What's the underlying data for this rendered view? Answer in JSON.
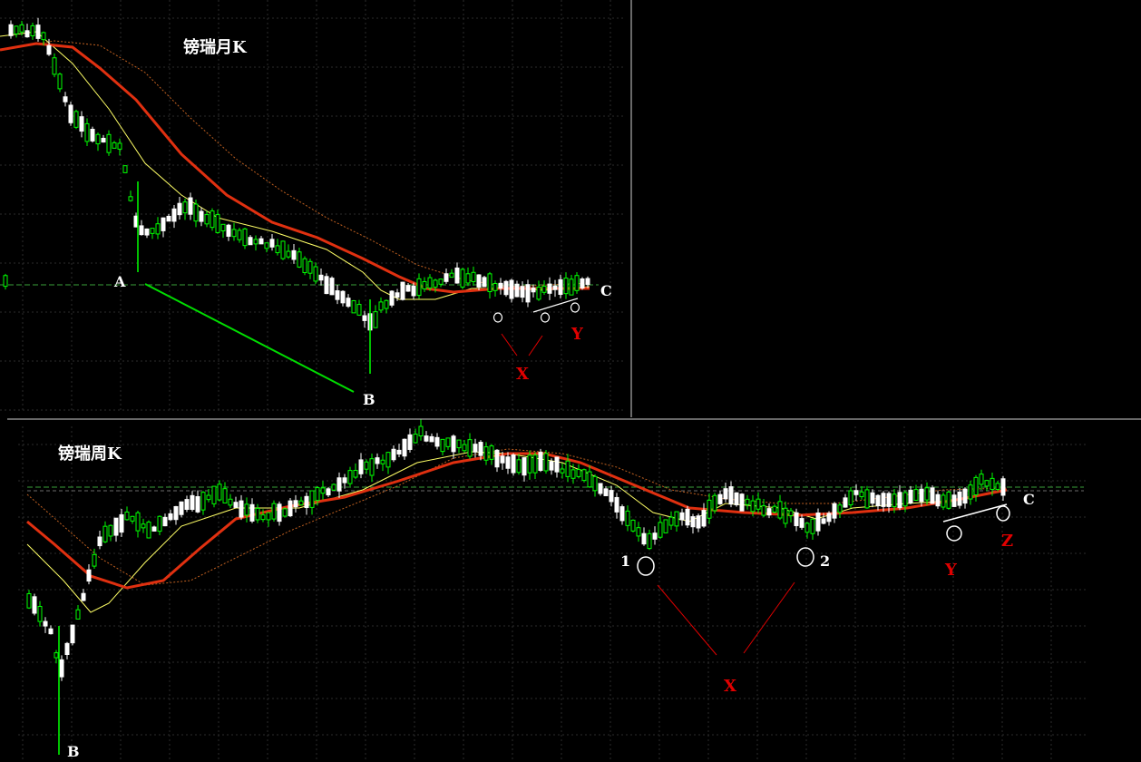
{
  "chart_data": [
    {
      "type": "candlestick",
      "title": "镑瑞月K",
      "annotations": {
        "A": "A",
        "B": "B",
        "C": "C",
        "X": "X",
        "Y": "Y"
      },
      "line_colors": {
        "up": "#00ff00",
        "down": "#ffffff",
        "ma_short": "#ffff66",
        "ma_long": "#e03010",
        "ma_dotted": "#c06020",
        "trend": "#00dd00",
        "marker": "#e00000"
      }
    },
    {
      "type": "candlestick",
      "title": "镑瑞周K",
      "annotations": {
        "B": "B",
        "C": "C",
        "X": "X",
        "Y": "Y",
        "Z": "Z",
        "p1": "1",
        "p2": "2"
      }
    }
  ]
}
